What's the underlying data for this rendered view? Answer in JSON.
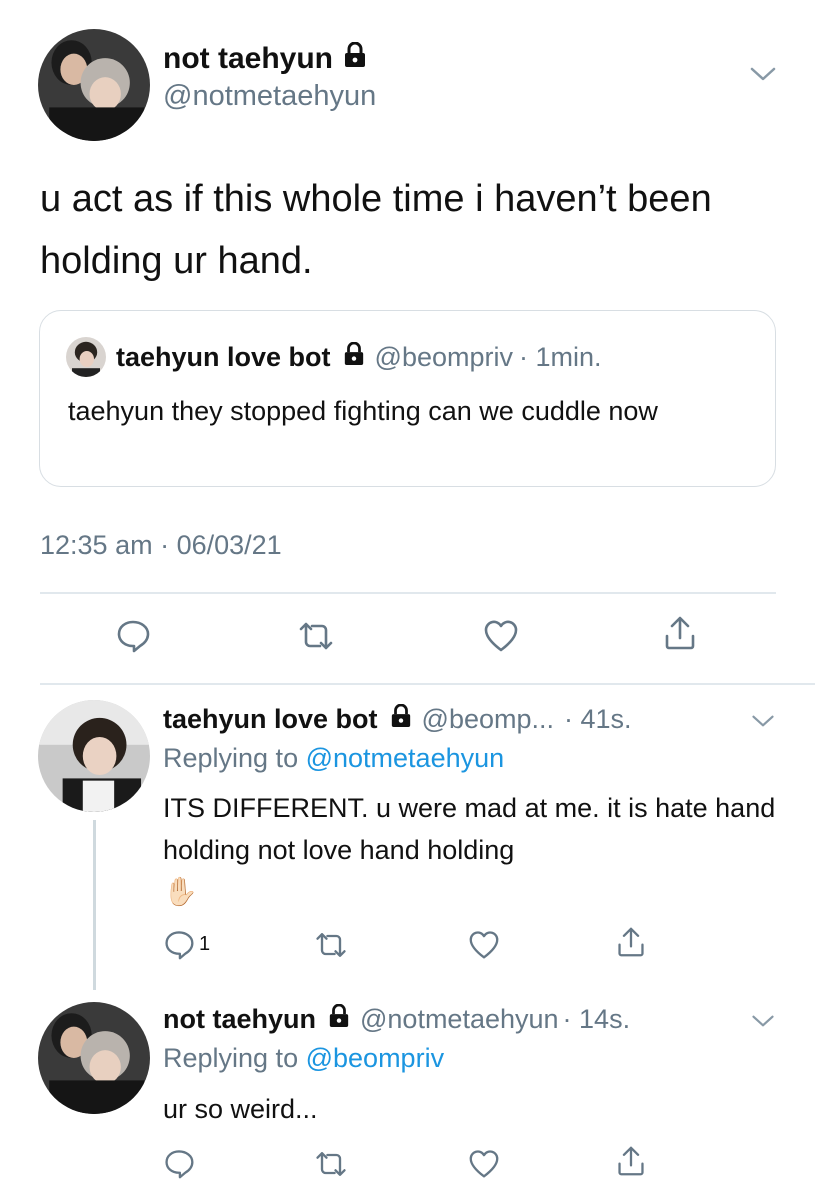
{
  "main_tweet": {
    "display_name": "not taehyun",
    "handle": "@notmetaehyun",
    "text": "u act as if this whole time i haven’t been holding ur hand.",
    "quote": {
      "display_name": "taehyun love bot",
      "handle": "@beompriv",
      "time": "· 1min.",
      "text": "taehyun they stopped fighting can we cuddle now"
    },
    "timestamp": "12:35 am · 06/03/21"
  },
  "replies": [
    {
      "display_name": "taehyun love bot",
      "handle": "@beomp...",
      "time": "· 41s.",
      "replying_prefix": "Replying to",
      "replying_to": "@notmetaehyun",
      "text": "ITS DIFFERENT. u were mad at me. it is hate hand holding not love hand holding",
      "emoji": "✋🏻",
      "reply_count": "1"
    },
    {
      "display_name": "not taehyun",
      "handle": "@notmetaehyun",
      "time": "· 14s.",
      "replying_prefix": "Replying to",
      "replying_to": "@beompriv",
      "text": "ur so weird...",
      "reply_count": ""
    }
  ],
  "colors": {
    "text": "#0f1419",
    "muted": "#657786",
    "link": "#1b95e0",
    "border": "#d8dee3"
  },
  "icons": [
    "lock-icon",
    "chevron-down-icon",
    "reply-icon",
    "retweet-icon",
    "like-icon",
    "share-icon"
  ]
}
